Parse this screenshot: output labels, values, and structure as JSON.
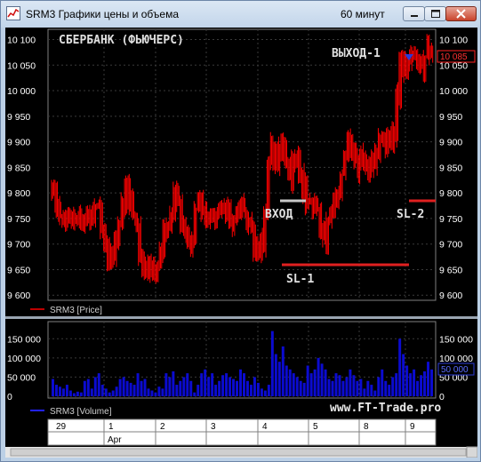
{
  "window": {
    "title": "SRM3 Графики цены и объема",
    "interval": "60 минут",
    "minimize_label": "minimize",
    "maximize_label": "maximize",
    "close_label": "close"
  },
  "price_chart": {
    "title": "СБЕРБАНК (ФЬЮЧЕРС)",
    "y_ticks": [
      "10 100",
      "10 050",
      "10 000",
      "9 950",
      "9 900",
      "9 850",
      "9 800",
      "9 750",
      "9 700",
      "9 650",
      "9 600"
    ],
    "current_price": "10 085",
    "legend": "SRM3 [Price]",
    "annotations": {
      "entry": "ВХОД",
      "exit": "ВЫХОД-1",
      "sl1": "SL-1",
      "sl2": "SL-2"
    },
    "colors": {
      "series": "#ff0000",
      "entry_mark": "#c8c8c8",
      "sl_line": "#e02020",
      "exit_marker": "#2b3bd6",
      "text": "#e0e0e0"
    }
  },
  "volume_chart": {
    "y_ticks": [
      "150 000",
      "100 000",
      "50 000",
      "0"
    ],
    "current_volume": "50 000",
    "legend": "SRM3 [Volume]",
    "watermark": "www.FT-Trade.pro",
    "colors": {
      "bars": "#0b0bd0"
    }
  },
  "time_axis": {
    "days": [
      "29",
      "1",
      "2",
      "3",
      "4",
      "5",
      "8",
      "9"
    ],
    "month": "Apr"
  },
  "chart_data": [
    {
      "type": "line",
      "title": "СБЕРБАНК (ФЬЮЧЕРС)",
      "legend": [
        "SRM3 [Price]"
      ],
      "ylim": [
        9590,
        10120
      ],
      "x_labels": [
        "29",
        "1",
        "2",
        "3",
        "4",
        "5",
        "8",
        "9"
      ],
      "series": [
        {
          "name": "SRM3 [Price]",
          "values": [
            9805,
            9770,
            9750,
            9760,
            9755,
            9745,
            9750,
            9760,
            9755,
            9740,
            9755,
            9760,
            9770,
            9780,
            9720,
            9690,
            9660,
            9680,
            9700,
            9740,
            9780,
            9820,
            9790,
            9760,
            9740,
            9680,
            9650,
            9640,
            9660,
            9650,
            9660,
            9680,
            9720,
            9740,
            9760,
            9800,
            9780,
            9750,
            9720,
            9700,
            9700,
            9760,
            9800,
            9760,
            9740,
            9760,
            9750,
            9760,
            9770,
            9780,
            9760,
            9740,
            9750,
            9770,
            9780,
            9760,
            9750,
            9730,
            9700,
            9680,
            9700,
            9760,
            9850,
            9890,
            9860,
            9880,
            9900,
            9860,
            9830,
            9860,
            9870,
            9840,
            9810,
            9790,
            9780,
            9770,
            9760,
            9730,
            9710,
            9740,
            9760,
            9790,
            9800,
            9840,
            9880,
            9900,
            9880,
            9860,
            9850,
            9870,
            9860,
            9840,
            9860,
            9880,
            9900,
            9900,
            9910,
            9900,
            9910,
            9990,
            10050,
            10040,
            10060,
            10080,
            10070,
            10050,
            10040,
            10060,
            10080,
            10085
          ]
        },
        {
          "name": "SRM3 [Volume]",
          "values": [
            45000,
            30000,
            25000,
            20000,
            30000,
            15000,
            8000,
            12000,
            10000,
            40000,
            45000,
            20000,
            50000,
            60000,
            30000,
            20000,
            10000,
            15000,
            25000,
            45000,
            50000,
            40000,
            35000,
            30000,
            60000,
            40000,
            45000,
            20000,
            15000,
            10000,
            25000,
            20000,
            60000,
            50000,
            65000,
            30000,
            40000,
            50000,
            60000,
            40000,
            10000,
            30000,
            60000,
            70000,
            50000,
            60000,
            30000,
            40000,
            55000,
            60000,
            50000,
            45000,
            40000,
            70000,
            60000,
            40000,
            30000,
            50000,
            35000,
            20000,
            15000,
            30000,
            170000,
            110000,
            90000,
            130000,
            80000,
            70000,
            60000,
            50000,
            40000,
            35000,
            80000,
            60000,
            70000,
            100000,
            85000,
            70000,
            45000,
            40000,
            60000,
            55000,
            40000,
            50000,
            70000,
            55000,
            40000,
            45000,
            20000,
            40000,
            30000,
            15000,
            50000,
            70000,
            40000,
            30000,
            50000,
            60000,
            150000,
            110000,
            80000,
            60000,
            70000,
            40000,
            55000,
            65000,
            90000,
            70000
          ]
        }
      ]
    }
  ]
}
